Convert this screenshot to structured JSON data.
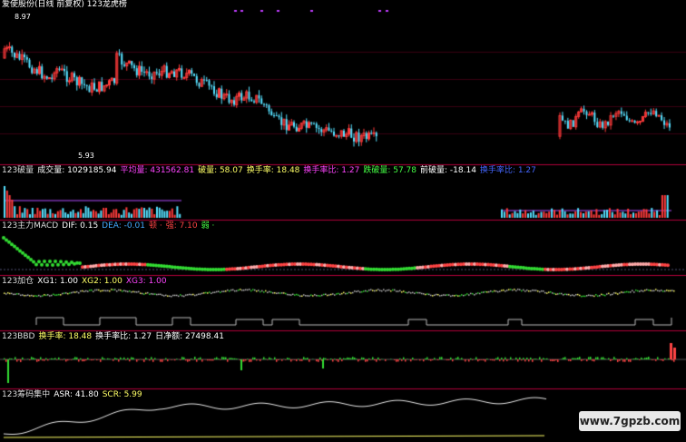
{
  "title": "爱使股份(日线 前复权) 123龙虎榜",
  "price_high": "8.97",
  "price_low": "5.93",
  "panel_volume": [
    {
      "text": "123破量",
      "color": "#dddddd"
    },
    {
      "text": "成交量: 1029185.94",
      "color": "#ffffff"
    },
    {
      "text": "平均量: 431562.81",
      "color": "#ff44ff"
    },
    {
      "text": "破量: 58.07",
      "color": "#ffff66"
    },
    {
      "text": "换手率: 18.48",
      "color": "#ffff66"
    },
    {
      "text": "换手率比: 1.27",
      "color": "#ff44ff"
    },
    {
      "text": "跌破量: 57.78",
      "color": "#44ff44"
    },
    {
      "text": "前破量: -18.14",
      "color": "#ffffff"
    },
    {
      "text": "换手率比: 1.27",
      "color": "#4466ff"
    }
  ],
  "panel_macd": [
    {
      "text": "123主力MACD",
      "color": "#dddddd"
    },
    {
      "text": "DIF: 0.15",
      "color": "#ffffff"
    },
    {
      "text": "DEA: -0.01",
      "color": "#44aaff"
    },
    {
      "text": "顿 ·",
      "color": "#ff4444"
    },
    {
      "text": "强: 7.10",
      "color": "#ff4444"
    },
    {
      "text": "弱 ·",
      "color": "#44ff44"
    }
  ],
  "panel_xg": [
    {
      "text": "123加仓",
      "color": "#dddddd"
    },
    {
      "text": "XG1: 1.00",
      "color": "#ffffff"
    },
    {
      "text": "XG2: 1.00",
      "color": "#ffff66"
    },
    {
      "text": "XG3: 1.00",
      "color": "#ff44ff"
    }
  ],
  "panel_bbd": [
    {
      "text": "123BBD",
      "color": "#dddddd"
    },
    {
      "text": "换手率: 18.48",
      "color": "#ffff66"
    },
    {
      "text": "换手率比: 1.27",
      "color": "#ffffff"
    },
    {
      "text": "日净额: 27498.41",
      "color": "#ffffff"
    }
  ],
  "panel_chip": [
    {
      "text": "123筹码集中",
      "color": "#dddddd"
    },
    {
      "text": "ASR: 41.80",
      "color": "#ffffff"
    },
    {
      "text": "SCR: 5.99",
      "color": "#ffff66"
    }
  ],
  "watermark": "www.7gpzb.com",
  "colors": {
    "up": "#ff3b3b",
    "down": "#55e0ff",
    "panel_border": "#b0003a"
  }
}
